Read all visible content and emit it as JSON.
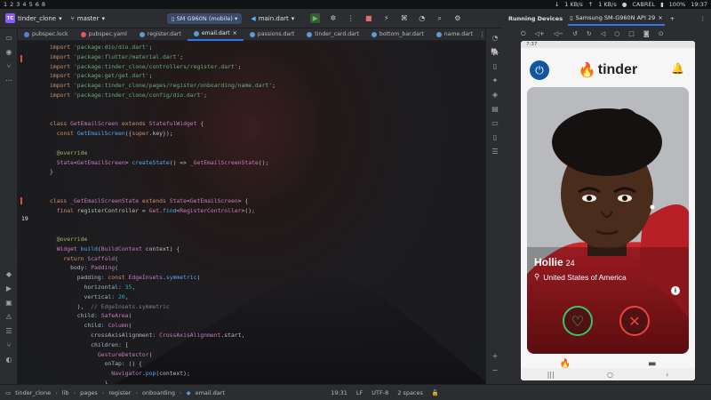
{
  "system": {
    "workspaces": [
      "1",
      "2",
      "3",
      "4",
      "5",
      "6",
      "8"
    ],
    "net_down": "1 KB/s",
    "net_up": "1 KB/s",
    "user": "CABREL",
    "battery": "100%",
    "time": "19:37"
  },
  "titlebar": {
    "project_badge": "TC",
    "project": "tinder_clone",
    "branch": "master",
    "device": "SM G960N (mobile)",
    "run_config": "main.dart"
  },
  "running_devices": {
    "label": "Running Devices",
    "device_tab": "Samsung SM-G960N API 29"
  },
  "tabs": [
    {
      "label": "pubspec.lock",
      "color": "#5b7fd6"
    },
    {
      "label": "pubspec.yaml",
      "color": "#d65b5b"
    },
    {
      "label": "register.dart",
      "color": "#5b9ad6"
    },
    {
      "label": "email.dart",
      "color": "#5b9ad6"
    },
    {
      "label": "passions.dart",
      "color": "#5b9ad6"
    },
    {
      "label": "tinder_card.dart",
      "color": "#5b9ad6"
    },
    {
      "label": "bottom_bar.dart",
      "color": "#5b9ad6"
    },
    {
      "label": "name.dart",
      "color": "#5b9ad6"
    }
  ],
  "editor": {
    "current_line": "19"
  },
  "phone": {
    "status_time": "7:37",
    "app_name": "tinder",
    "profile_name": "Hollie",
    "profile_age": "24",
    "profile_location": "United States of America"
  },
  "statusbar": {
    "breadcrumbs": [
      "tinder_clone",
      "lib",
      "pages",
      "register",
      "onboarding",
      "email.dart"
    ],
    "position": "19:31",
    "line_ending": "LF",
    "encoding": "UTF-8",
    "indent": "2 spaces"
  },
  "colors": {
    "accent": "#3574f0",
    "tinder": "#f14e52",
    "like": "#3fc06a",
    "nope": "#f0413c"
  }
}
